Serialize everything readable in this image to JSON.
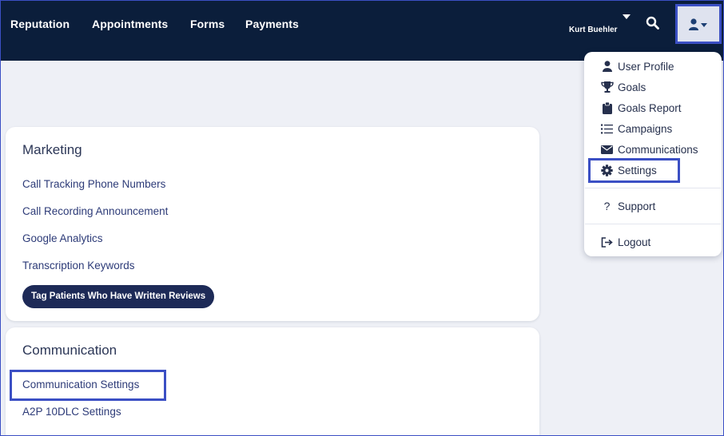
{
  "nav": {
    "items": [
      "Reputation",
      "Appointments",
      "Forms",
      "Payments"
    ],
    "user_name": "Kurt Buehler"
  },
  "icons": {
    "search": "search-icon",
    "user": "user-icon",
    "caret": "caret-down-icon"
  },
  "colors": {
    "nav_bg": "#0b1e3b",
    "highlight": "#3b4fc4",
    "link": "#2d3b78",
    "pill_bg": "#1d2a57"
  },
  "marketing": {
    "title": "Marketing",
    "links": [
      "Call Tracking Phone Numbers",
      "Call Recording Announcement",
      "Google Analytics",
      "Transcription Keywords"
    ],
    "pill_label": "Tag Patients Who Have Written Reviews"
  },
  "communication": {
    "title": "Communication",
    "links": [
      "Communication Settings",
      "A2P 10DLC Settings"
    ]
  },
  "dropdown": {
    "items": [
      {
        "label": "User Profile",
        "icon": "user-icon"
      },
      {
        "label": "Goals",
        "icon": "trophy-icon"
      },
      {
        "label": "Goals Report",
        "icon": "clipboard-icon"
      },
      {
        "label": "Campaigns",
        "icon": "list-icon"
      },
      {
        "label": "Communications",
        "icon": "envelope-icon"
      },
      {
        "label": "Settings",
        "icon": "gear-icon"
      }
    ],
    "support_label": "Support",
    "logout_label": "Logout"
  }
}
